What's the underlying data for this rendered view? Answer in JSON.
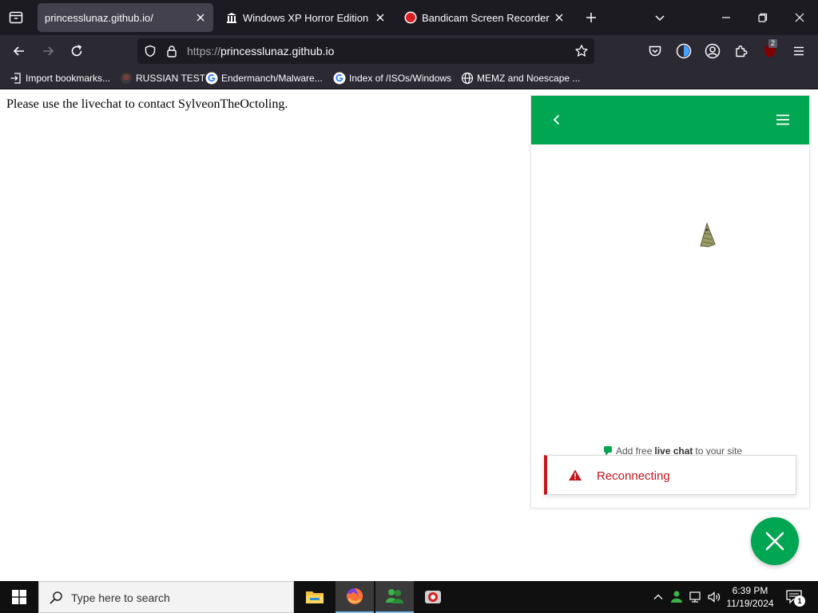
{
  "browser": {
    "tabs": [
      {
        "title": "princesslunaz.github.io/",
        "active": true
      },
      {
        "title": "Windows XP Horror Edition (De",
        "active": false
      },
      {
        "title": "Bandicam Screen Recorder Dow",
        "active": false
      }
    ],
    "url": {
      "protocol": "https://",
      "host": "princesslunaz.github.io"
    },
    "extension_badge": "2",
    "bookmarks": [
      {
        "label": "Import bookmarks...",
        "icon": "import-icon"
      },
      {
        "label": "RUSSIAN TEST",
        "icon": "github-icon"
      },
      {
        "label": "Endermanch/Malware...",
        "icon": "google-icon"
      },
      {
        "label": "Index of /ISOs/Windows",
        "icon": "google-icon"
      },
      {
        "label": "MEMZ and Noescape ...",
        "icon": "globe-icon"
      }
    ]
  },
  "page": {
    "message": "Please use the livechat to contact SylveonTheOctoling."
  },
  "chat": {
    "accent": "#00a651",
    "powered_prefix": "Add free",
    "powered_bold": "live chat",
    "powered_suffix": "to your site",
    "status": "Reconnecting",
    "status_color": "#c4161c"
  },
  "taskbar": {
    "search_placeholder": "Type here to search",
    "time": "6:39 PM",
    "date": "11/19/2024",
    "notification_count": "1"
  }
}
